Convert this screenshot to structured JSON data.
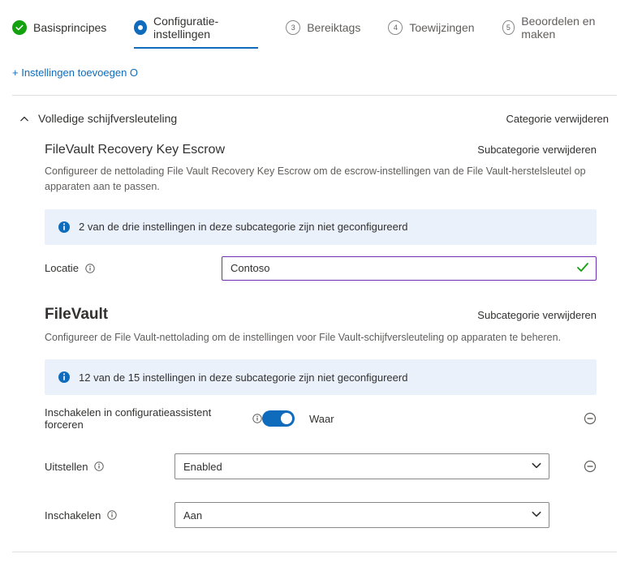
{
  "stepper": {
    "items": [
      {
        "label": "Basisprincipes",
        "state": "done"
      },
      {
        "label": "Configuratie-instellingen",
        "state": "active"
      },
      {
        "num": "3",
        "label": "Bereiktags"
      },
      {
        "num": "4",
        "label": "Toewijzingen"
      },
      {
        "num": "5",
        "label": "Beoordelen en maken"
      }
    ]
  },
  "add_settings_label": "+ Instellingen toevoegen O",
  "category": {
    "title": "Volledige schijfversleuteling",
    "remove_label": "Categorie verwijderen"
  },
  "escrow": {
    "title": "FileVault Recovery Key Escrow",
    "remove_label": "Subcategorie verwijderen",
    "description": "Configureer de nettolading File Vault Recovery Key Escrow om de escrow-instellingen van de File Vault-herstelsleutel op apparaten aan te passen.",
    "info_msg": "2 van de drie instellingen in deze subcategorie zijn niet geconfigureerd",
    "location_label": "Locatie",
    "location_value": "Contoso"
  },
  "filevault": {
    "title": "FileVault",
    "remove_label": "Subcategorie verwijderen",
    "description": "Configureer de File Vault-nettolading om de instellingen voor File Vault-schijfversleuteling op apparaten te beheren.",
    "info_msg": "12 van de 15 instellingen in deze subcategorie zijn niet geconfigureerd",
    "force_enable_label": "Inschakelen in configuratieassistent forceren",
    "force_enable_value": "Waar",
    "defer_label": "Uitstellen",
    "defer_value": "Enabled",
    "enable_label": "Inschakelen",
    "enable_value": "Aan"
  }
}
